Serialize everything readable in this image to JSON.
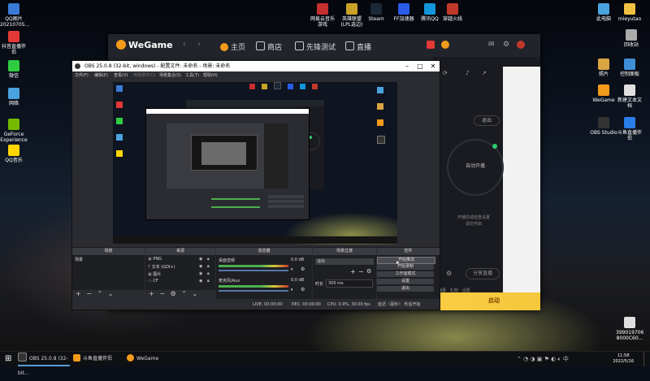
{
  "desktop": {
    "left_icons": [
      {
        "label": "QQ图片 20210705...",
        "color": "#3a7bd5"
      },
      {
        "label": "抖音直播伴侣",
        "color": "#e53935"
      },
      {
        "label": "微信",
        "color": "#2ecc40"
      },
      {
        "label": "网络",
        "color": "#4aa3df"
      },
      {
        "label": "GeForce Experience",
        "color": "#76b900"
      },
      {
        "label": "QQ音乐",
        "color": "#ffd600"
      }
    ],
    "right_icons": [
      {
        "label": "此电脑",
        "color": "#4aa3df"
      },
      {
        "label": "mieyutao",
        "color": "#f0c040"
      },
      {
        "label": "回收站",
        "color": "#aaaaaa"
      },
      {
        "label": "照片",
        "color": "#d9a441"
      },
      {
        "label": "控制面板",
        "color": "#3d8fd6"
      },
      {
        "label": "WeGame",
        "color": "#f39b1b"
      },
      {
        "label": "新建文本文档",
        "color": "#e0e0e0"
      },
      {
        "label": "OBS Studio",
        "color": "#333333"
      },
      {
        "label": "斗鱼直播伴侣",
        "color": "#2b7de9"
      },
      {
        "label": "399019706 8000C60...",
        "color": "#e0e0e0"
      }
    ],
    "top_icons": [
      {
        "label": "网易云音乐 游戏",
        "color": "#c62f2f"
      },
      {
        "label": "英雄联盟 (LPL选边)",
        "color": "#c9a227"
      },
      {
        "label": "Steam",
        "color": "#1b2838"
      },
      {
        "label": "FF加速器",
        "color": "#2b5be9"
      },
      {
        "label": "腾讯QQ",
        "color": "#1296db"
      },
      {
        "label": "穿越火线",
        "color": "#c0392b"
      }
    ]
  },
  "wegame": {
    "logo": "WeGame",
    "nav": {
      "home": "主页",
      "store": "商店",
      "pioneer": "先锋测试",
      "live": "直播"
    },
    "panel": {
      "logout": "退出",
      "ring_label": "自动开播",
      "tip1": "开播前请检查设置",
      "tip2": "请勿开启",
      "share": "分享直播",
      "bottom_links": [
        "弹幕",
        "礼物",
        "设置"
      ],
      "start": "启动"
    }
  },
  "obs": {
    "title": "OBS 25.0.8 (32-bit, windows) - 配置文件: 未命名 - 场景: 未命名",
    "menu": [
      "文件(F)",
      "编辑(E)",
      "查看(V)",
      "停靠部件(D)",
      "场景集合(S)",
      "工具(T)",
      "帮助(H)"
    ],
    "docks": {
      "scenes": {
        "title": "场景",
        "items": [
          "场景"
        ]
      },
      "sources": {
        "title": "来源",
        "items": [
          "PNG",
          "文本 (GDI+)",
          "图片",
          "CF"
        ]
      },
      "mixer": {
        "title": "混音器",
        "channels": [
          {
            "name": "桌面音频",
            "db": "0.0 dB"
          },
          {
            "name": "麦克风/Aux",
            "db": "0.0 dB"
          }
        ]
      },
      "transitions": {
        "title": "场景过渡",
        "type": "淡出",
        "duration_label": "时长",
        "duration": "300 ms"
      },
      "controls": {
        "title": "控件",
        "buttons": [
          "开始推流",
          "开始录制",
          "工作室模式",
          "设置",
          "退出"
        ]
      }
    },
    "status": {
      "live": "LIVE: 00:00:00",
      "rec": "REC: 00:00:00",
      "cpu": "CPU: 0.9%, 30.00 fps",
      "hint": "延迟（毫秒）：秒后开始"
    }
  },
  "taskbar": {
    "items": [
      {
        "label": "OBS 25.0.8 (32-bit...",
        "color": "#333333"
      },
      {
        "label": "斗鱼直播伴侣",
        "color": "#2b7de9"
      },
      {
        "label": "WeGame",
        "color": "#f39b1b"
      }
    ],
    "time": "11:58",
    "date": "2022/5/16"
  }
}
